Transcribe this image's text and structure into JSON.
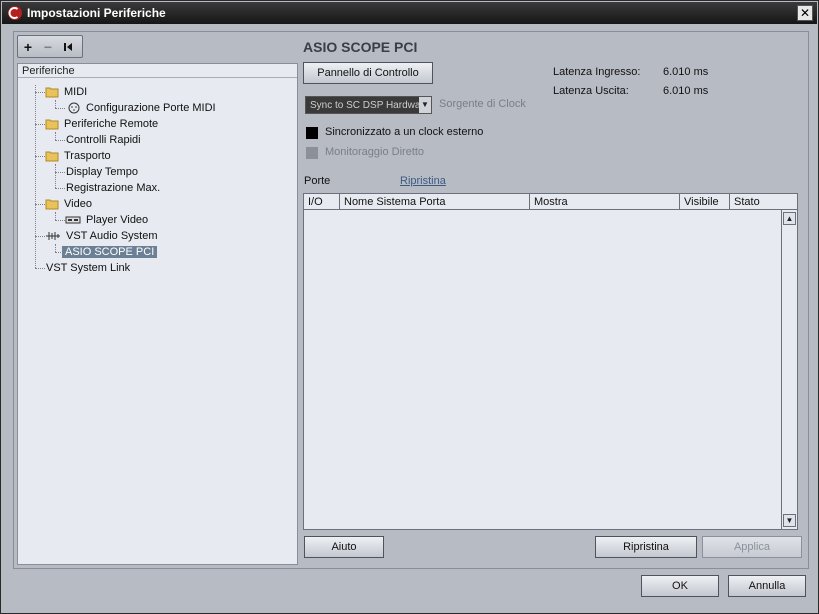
{
  "window": {
    "title": "Impostazioni Periferiche",
    "close_glyph": "✕"
  },
  "toolbar": {
    "add": "+",
    "remove": "−",
    "reset": "⏮"
  },
  "tree": {
    "header": "Periferiche",
    "items": [
      {
        "label": "MIDI",
        "icon": "folder-icon"
      },
      {
        "label": "Configurazione Porte MIDI",
        "icon": "midi-port-icon"
      },
      {
        "label": "Periferiche Remote",
        "icon": "folder-icon"
      },
      {
        "label": "Controlli Rapidi",
        "icon": ""
      },
      {
        "label": "Trasporto",
        "icon": "folder-icon"
      },
      {
        "label": "Display Tempo",
        "icon": ""
      },
      {
        "label": "Registrazione Max.",
        "icon": ""
      },
      {
        "label": "Video",
        "icon": "folder-icon"
      },
      {
        "label": "Player Video",
        "icon": "video-player-icon"
      },
      {
        "label": "VST Audio System",
        "icon": "audio-system-icon"
      },
      {
        "label": "ASIO SCOPE PCI",
        "icon": "",
        "selected": true
      },
      {
        "label": "VST System Link",
        "icon": ""
      }
    ]
  },
  "panel": {
    "title": "ASIO SCOPE PCI",
    "control_panel_button": "Pannello di Controllo",
    "latency_input_label": "Latenza Ingresso:",
    "latency_input_value": "6.010 ms",
    "latency_output_label": "Latenza Uscita:",
    "latency_output_value": "6.010 ms",
    "clock_source_value": "Sync to SC DSP Hardwa",
    "clock_source_label": "Sorgente di Clock",
    "external_clock_label": "Sincronizzato a un clock esterno",
    "direct_monitoring_label": "Monitoraggio Diretto",
    "ports_label": "Porte",
    "reset_link": "Ripristina",
    "columns": [
      "I/O",
      "Nome Sistema Porta",
      "Mostra",
      "Visibile",
      "Stato"
    ]
  },
  "buttons": {
    "help": "Aiuto",
    "reset": "Ripristina",
    "apply": "Applica",
    "ok": "OK",
    "cancel": "Annulla"
  },
  "colors": {
    "accent": "#6b7f95",
    "link": "#3d5b83"
  }
}
